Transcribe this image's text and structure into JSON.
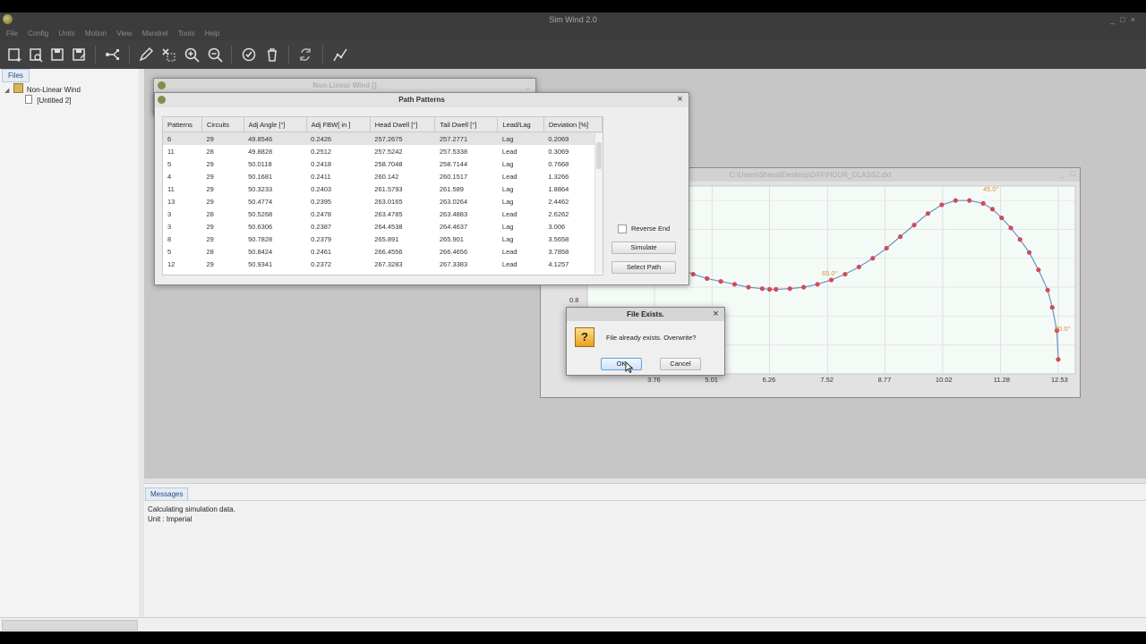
{
  "app": {
    "title": "Sim Wind 2.0"
  },
  "menu": [
    "File",
    "Config",
    "Units",
    "Motion",
    "View",
    "Mandrel",
    "Tools",
    "Help"
  ],
  "toolbar_icons": [
    "new-file-icon",
    "open-file-icon",
    "save-icon",
    "save-as-icon",
    "path-tree-icon",
    "pencil-icon",
    "delete-selection-icon",
    "zoom-in-icon",
    "zoom-out-icon",
    "check-icon",
    "trash-icon",
    "refresh-icon",
    "graph-icon"
  ],
  "sidebar": {
    "tab": "Files",
    "tree": [
      {
        "label": "Non-Linear Wind",
        "level": 0
      },
      {
        "label": "[Untitled 2]",
        "level": 1
      }
    ]
  },
  "messages": {
    "tab": "Messages",
    "lines": [
      "Calculating simulation data.",
      "Unit : Imperial"
    ]
  },
  "nonlinear_window": {
    "title": "Non-Linear Wind []"
  },
  "path_patterns": {
    "title": "Path Patterns",
    "columns": [
      "Patterns",
      "Circuits",
      "Adj Angle [°]",
      "Adj FBW[ in ]",
      "Head Dwell [°]",
      "Tail Dwell [°]",
      "Lead/Lag",
      "Deviation [%]"
    ],
    "rows": [
      [
        "6",
        "29",
        "49.8546",
        "0.2426",
        "257.2675",
        "257.2771",
        "Lag",
        "0.2069"
      ],
      [
        "11",
        "28",
        "49.8828",
        "0.2512",
        "257.5242",
        "257.5338",
        "Lead",
        "0.3069"
      ],
      [
        "5",
        "29",
        "50.0118",
        "0.2418",
        "258.7048",
        "258.7144",
        "Lag",
        "0.7668"
      ],
      [
        "4",
        "29",
        "50.1681",
        "0.2411",
        "260.142",
        "260.1517",
        "Lead",
        "1.3266"
      ],
      [
        "11",
        "29",
        "50.3233",
        "0.2403",
        "261.5793",
        "261.589",
        "Lag",
        "1.8864"
      ],
      [
        "13",
        "29",
        "50.4774",
        "0.2395",
        "263.0165",
        "263.0264",
        "Lag",
        "2.4462"
      ],
      [
        "3",
        "28",
        "50.5268",
        "0.2478",
        "263.4785",
        "263.4883",
        "Lead",
        "2.6262"
      ],
      [
        "3",
        "29",
        "50.6306",
        "0.2387",
        "264.4538",
        "264.4637",
        "Lag",
        "3.006"
      ],
      [
        "8",
        "29",
        "50.7828",
        "0.2379",
        "265.891",
        "265.901",
        "Lag",
        "3.5658"
      ],
      [
        "5",
        "28",
        "50.8424",
        "0.2461",
        "266.4556",
        "266.4656",
        "Lead",
        "3.7858"
      ],
      [
        "12",
        "29",
        "50.9341",
        "0.2372",
        "267.3283",
        "267.3383",
        "Lead",
        "4.1257"
      ]
    ],
    "reverse_end_label": "Reverse End",
    "reverse_end_checked": false,
    "simulate_label": "Simulate",
    "select_path_label": "Select Path"
  },
  "chart_window": {
    "title": "C:\\Users\\Sharat\\Desktop\\DXF\\HOUR_GLASS2.dxf"
  },
  "chart_data": {
    "type": "line",
    "x_ticks": [
      "3.76",
      "5.01",
      "6.26",
      "7.52",
      "8.77",
      "10.02",
      "11.28",
      "12.53"
    ],
    "y_ticks": [
      "0.8"
    ],
    "annotations": [
      "45.0°",
      "65.0°",
      "90.0°"
    ],
    "xlim": [
      2.3,
      12.9
    ],
    "ylim": [
      0.4,
      1.7
    ],
    "series": [
      {
        "x": [
          2.3,
          2.6,
          2.9,
          3.2,
          3.5,
          3.76,
          4.0,
          4.3,
          4.6,
          4.9,
          5.2,
          5.5,
          5.8,
          6.1,
          6.26,
          6.4,
          6.7,
          7.0,
          7.3,
          7.6,
          7.9,
          8.2,
          8.5,
          8.8,
          9.1,
          9.4,
          9.7,
          10.0,
          10.3,
          10.6,
          10.9,
          11.1,
          11.3,
          11.5,
          11.7,
          11.9,
          12.1,
          12.3,
          12.4,
          12.5,
          12.53
        ],
        "y": [
          1.5,
          1.42,
          1.36,
          1.31,
          1.25,
          1.21,
          1.17,
          1.13,
          1.09,
          1.06,
          1.04,
          1.02,
          1.0,
          0.99,
          0.985,
          0.985,
          0.99,
          1.0,
          1.02,
          1.05,
          1.09,
          1.14,
          1.2,
          1.27,
          1.35,
          1.43,
          1.51,
          1.57,
          1.6,
          1.6,
          1.58,
          1.54,
          1.48,
          1.41,
          1.33,
          1.24,
          1.12,
          0.98,
          0.86,
          0.7,
          0.5
        ]
      }
    ]
  },
  "dialog": {
    "title": "File Exists.",
    "message": "File already exists. Overwrite?",
    "ok_label": "OK",
    "cancel_label": "Cancel"
  }
}
